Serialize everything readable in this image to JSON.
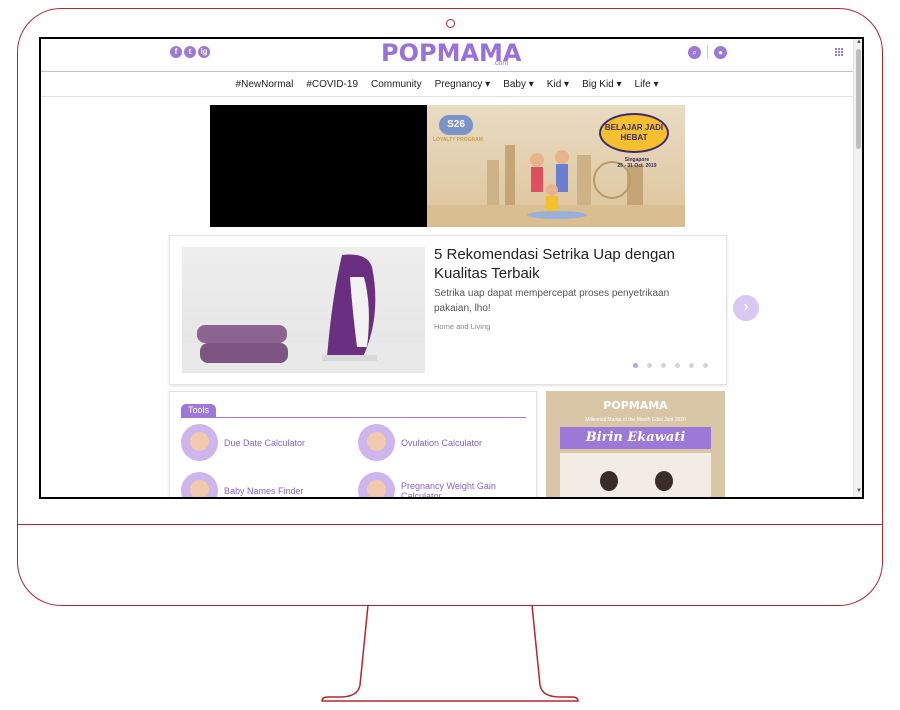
{
  "site": {
    "logo": "POPMAMA",
    "logo_sub": ".com",
    "social": [
      "f",
      "t",
      "ig"
    ]
  },
  "nav": {
    "items": [
      "#NewNormal",
      "#COVID-19",
      "Community",
      "Pregnancy ▾",
      "Baby ▾",
      "Kid ▾",
      "Big Kid ▾",
      "Life ▾"
    ]
  },
  "ad": {
    "brand": "S26",
    "program": "LOYALTY PROGRAM",
    "headline_1": "BELAJAR JADI",
    "headline_2": "HEBAT",
    "location": "Singapore",
    "date": "25 - 31 Oct. 2019"
  },
  "featured": {
    "title": "5 Rekomendasi Setrika Uap dengan Kualitas Terbaik",
    "description": "Setrika uap dapat mempercepat proses penyetrikaan pakaian, lho!",
    "category": "Home and Living",
    "slide_count": 6,
    "active_slide": 1
  },
  "tools": {
    "heading": "Tools",
    "items": [
      {
        "label": "Due Date Calculator",
        "icon": "pregnant-mom-icon"
      },
      {
        "label": "Ovulation Calculator",
        "icon": "egg-icon"
      },
      {
        "label": "Baby Names Finder",
        "icon": "baby-icon"
      },
      {
        "label": "Pregnancy Weight Gain Calculator",
        "icon": "scale-icon"
      }
    ]
  },
  "promo": {
    "logo": "POPMAMA",
    "subtitle": "Millennial Mama of the Month Edisi Juni 2020",
    "name": "Birin Ekawati"
  },
  "colors": {
    "brand": "#9b6fdc",
    "monitor_outline": "#b8252f"
  }
}
